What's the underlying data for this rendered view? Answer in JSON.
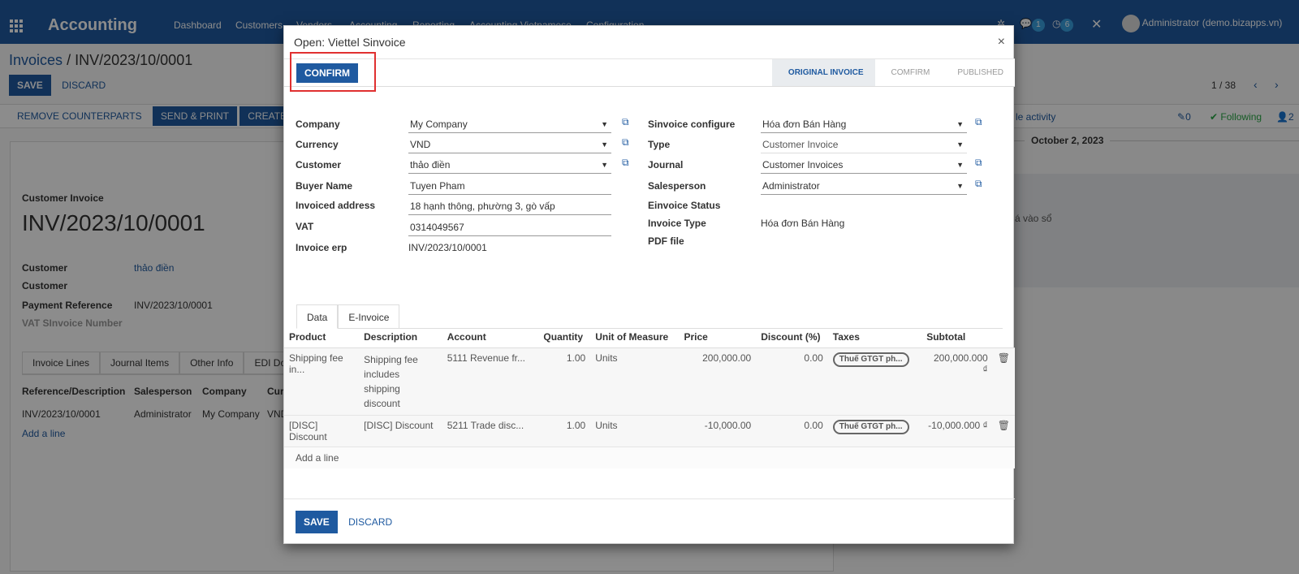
{
  "navbar": {
    "brand": "Accounting",
    "menu": [
      "Dashboard",
      "Customers",
      "Vendors",
      "Accounting",
      "Reporting",
      "Accounting Vietnamese",
      "Configuration"
    ],
    "chat_count": "1",
    "activity_count": "6",
    "user": "Administrator (demo.bizapps.vn)"
  },
  "page": {
    "breadcrumb_root": "Invoices",
    "breadcrumb_sep": "/",
    "breadcrumb_current": "INV/2023/10/0001",
    "save_label": "SAVE",
    "discard_label": "DISCARD",
    "pager": "1 / 38",
    "actions": [
      "REMOVE COUNTERPARTS",
      "SEND & PRINT",
      "CREATE S-INV"
    ],
    "schedule_activity": "le activity",
    "attachments": "0",
    "following": "Following",
    "followers": "2",
    "date_sep": "October 2, 2023",
    "chatter_note": "á vào sổ",
    "doc_type": "Customer Invoice",
    "doc_number": "INV/2023/10/0001",
    "fields": [
      {
        "label": "Customer",
        "value": "thảo điền"
      },
      {
        "label": "Customer",
        "value": ""
      },
      {
        "label": "Payment Reference",
        "value": "INV/2023/10/0001"
      },
      {
        "label": "VAT SInvoice Number",
        "value": ""
      }
    ],
    "tabs": [
      "Invoice Lines",
      "Journal Items",
      "Other Info",
      "EDI Docu"
    ],
    "line_headers": [
      "Reference/Description",
      "Salesperson",
      "Company",
      "Curr"
    ],
    "line_row": [
      "INV/2023/10/0001",
      "Administrator",
      "My Company",
      "VND"
    ],
    "add_line": "Add a line"
  },
  "modal": {
    "title": "Open: Viettel Sinvoice",
    "close": "×",
    "confirm_label": "CONFIRM",
    "steps": [
      "ORIGINAL INVOICE",
      "COMFIRM",
      "PUBLISHED"
    ],
    "left_fields": [
      {
        "label": "Company",
        "value": "My Company"
      },
      {
        "label": "Currency",
        "value": "VND"
      },
      {
        "label": "Customer",
        "value": "thảo điền"
      },
      {
        "label": "Buyer Name",
        "value": "Tuyen Pham"
      },
      {
        "label": "Invoiced address",
        "value": "18 hạnh thông, phường 3, gò vấp"
      },
      {
        "label": "VAT",
        "value": "0314049567"
      },
      {
        "label": "Invoice erp",
        "value": "INV/2023/10/0001"
      }
    ],
    "right_fields": [
      {
        "label": "Sinvoice configure",
        "value": "Hóa đơn Bán Hàng"
      },
      {
        "label": "Type",
        "value": "Customer Invoice"
      },
      {
        "label": "Journal",
        "value": "Customer Invoices"
      },
      {
        "label": "Salesperson",
        "value": "Administrator"
      },
      {
        "label": "Einvoice Status",
        "value": ""
      },
      {
        "label": "Invoice Type",
        "value": "Hóa đơn Bán Hàng"
      },
      {
        "label": "PDF file",
        "value": ""
      }
    ],
    "tabs": [
      "Data",
      "E-Invoice"
    ],
    "table_headers": [
      "Product",
      "Description",
      "Account",
      "Quantity",
      "Unit of Measure",
      "Price",
      "Discount (%)",
      "Taxes",
      "Subtotal"
    ],
    "rows": [
      {
        "product": "Shipping fee in...",
        "description": "Shipping fee includes shipping discount",
        "account": "5111 Revenue fr...",
        "quantity": "1.00",
        "uom": "Units",
        "price": "200,000.00",
        "discount": "0.00",
        "tax": "Thuế GTGT ph...",
        "subtotal": "200,000.000 ₫"
      },
      {
        "product": "[DISC] Discount",
        "description": "[DISC] Discount",
        "account": "5211 Trade disc...",
        "quantity": "1.00",
        "uom": "Units",
        "price": "-10,000.00",
        "discount": "0.00",
        "tax": "Thuế GTGT ph...",
        "subtotal": "-10,000.000 ₫"
      }
    ],
    "add_line": "Add a line",
    "save_label": "SAVE",
    "discard_label": "DISCARD"
  }
}
